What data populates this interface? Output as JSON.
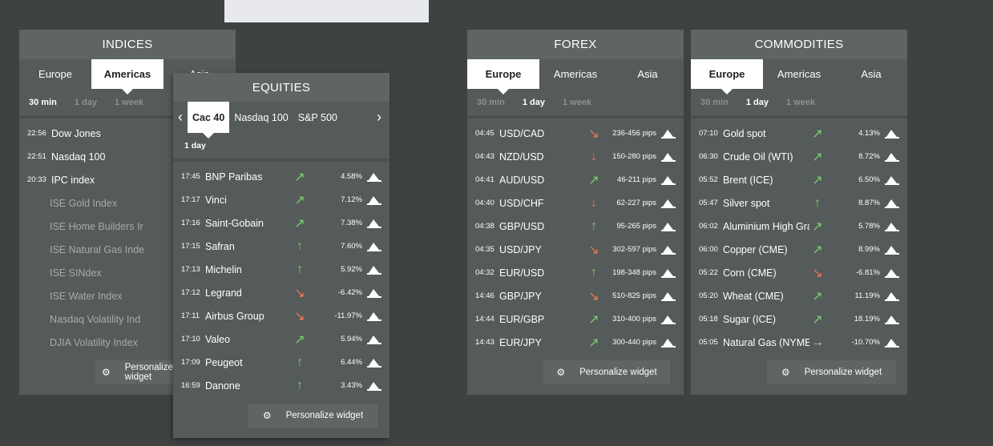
{
  "indices": {
    "title": "INDICES",
    "tabs": [
      "Europe",
      "Americas",
      "Asia"
    ],
    "active_tab": 1,
    "periods": [
      "30 min",
      "1 day",
      "1 week"
    ],
    "active_period": 0,
    "rows": [
      {
        "time": "22:56",
        "name": "Dow Jones",
        "arrow": "↗"
      },
      {
        "time": "22:51",
        "name": "Nasdaq 100",
        "arrow": "↗"
      },
      {
        "time": "20:33",
        "name": "IPC index",
        "arrow": "↗"
      }
    ],
    "dim_rows": [
      "ISE Gold Index",
      "ISE Home Builders Ir",
      "ISE Natural Gas Inde",
      "ISE SINdex",
      "ISE Water Index",
      "Nasdaq Volatility Ind",
      "DJIA Volatility Index"
    ],
    "dash": "-",
    "personalize": "Personalize widget"
  },
  "equities": {
    "title": "EQUITIES",
    "sub_tabs": [
      "Cac 40",
      "Nasdaq 100",
      "S&P 500"
    ],
    "period": "1 day",
    "rows": [
      {
        "time": "17:45",
        "name": "BNP Paribas",
        "arrow": "↗",
        "dir": "up-green",
        "val": "4.58%"
      },
      {
        "time": "17:17",
        "name": "Vinci",
        "arrow": "↗",
        "dir": "up-green",
        "val": "7.12%"
      },
      {
        "time": "17:16",
        "name": "Saint-Gobain",
        "arrow": "↗",
        "dir": "up-green",
        "val": "7.38%"
      },
      {
        "time": "17:15",
        "name": "Safran",
        "arrow": "↑",
        "dir": "up-green",
        "val": "7.60%"
      },
      {
        "time": "17:13",
        "name": "Michelin",
        "arrow": "↑",
        "dir": "up-green",
        "val": "5.92%"
      },
      {
        "time": "17:12",
        "name": "Legrand",
        "arrow": "↘",
        "dir": "down-red",
        "val": "-6.42%"
      },
      {
        "time": "17:11",
        "name": "Airbus Group",
        "arrow": "↘",
        "dir": "down-red",
        "val": "-11.97%"
      },
      {
        "time": "17:10",
        "name": "Valeo",
        "arrow": "↗",
        "dir": "up-green",
        "val": "5.94%"
      },
      {
        "time": "17:09",
        "name": "Peugeot",
        "arrow": "↑",
        "dir": "up-green",
        "val": "6.44%"
      },
      {
        "time": "16:59",
        "name": "Danone",
        "arrow": "↑",
        "dir": "up-green",
        "val": "3.43%"
      }
    ],
    "personalize": "Personalize widget"
  },
  "forex": {
    "title": "FOREX",
    "tabs": [
      "Europe",
      "Americas",
      "Asia"
    ],
    "active_tab": 0,
    "periods": [
      "30 min",
      "1 day",
      "1 week"
    ],
    "active_period": 1,
    "rows": [
      {
        "time": "04:45",
        "name": "USD/CAD",
        "arrow": "↘",
        "dir": "down-red",
        "val": "236-456 pips"
      },
      {
        "time": "04:43",
        "name": "NZD/USD",
        "arrow": "↓",
        "dir": "down-red",
        "val": "150-280 pips"
      },
      {
        "time": "04:41",
        "name": "AUD/USD",
        "arrow": "↗",
        "dir": "up-green",
        "val": "46-211 pips"
      },
      {
        "time": "04:40",
        "name": "USD/CHF",
        "arrow": "↓",
        "dir": "down-red",
        "val": "62-227 pips"
      },
      {
        "time": "04:38",
        "name": "GBP/USD",
        "arrow": "↑",
        "dir": "up-green",
        "val": "95-265 pips"
      },
      {
        "time": "04:35",
        "name": "USD/JPY",
        "arrow": "↘",
        "dir": "down-red",
        "val": "302-597 pips"
      },
      {
        "time": "04:32",
        "name": "EUR/USD",
        "arrow": "↑",
        "dir": "up-green",
        "val": "198-348 pips"
      },
      {
        "time": "14:46",
        "name": "GBP/JPY",
        "arrow": "↘",
        "dir": "down-red",
        "val": "510-825 pips"
      },
      {
        "time": "14:44",
        "name": "EUR/GBP",
        "arrow": "↗",
        "dir": "up-green",
        "val": "310-400 pips"
      },
      {
        "time": "14:43",
        "name": "EUR/JPY",
        "arrow": "↗",
        "dir": "up-green",
        "val": "300-440 pips"
      }
    ],
    "personalize": "Personalize widget"
  },
  "commodities": {
    "title": "COMMODITIES",
    "tabs": [
      "Europe",
      "Americas",
      "Asia"
    ],
    "active_tab": 0,
    "periods": [
      "30 min",
      "1 day",
      "1 week"
    ],
    "active_period": 1,
    "rows": [
      {
        "time": "07:10",
        "name": "Gold spot",
        "arrow": "↗",
        "dir": "up-green",
        "val": "4.13%"
      },
      {
        "time": "06:30",
        "name": "Crude Oil (WTI)",
        "arrow": "↗",
        "dir": "up-green",
        "val": "8.72%"
      },
      {
        "time": "05:52",
        "name": "Brent (ICE)",
        "arrow": "↗",
        "dir": "up-green",
        "val": "6.50%"
      },
      {
        "time": "05:47",
        "name": "Silver spot",
        "arrow": "↑",
        "dir": "up-green",
        "val": "8.87%"
      },
      {
        "time": "06:02",
        "name": "Aluminium High Gra",
        "arrow": "↗",
        "dir": "up-green",
        "val": "5.78%"
      },
      {
        "time": "06:00",
        "name": "Copper (CME)",
        "arrow": "↗",
        "dir": "up-green",
        "val": "8.99%"
      },
      {
        "time": "05:22",
        "name": "Corn (CME)",
        "arrow": "↘",
        "dir": "down-red",
        "val": "-6.81%"
      },
      {
        "time": "05:20",
        "name": "Wheat (CME)",
        "arrow": "↗",
        "dir": "up-green",
        "val": "11.19%"
      },
      {
        "time": "05:18",
        "name": "Sugar (ICE)",
        "arrow": "↗",
        "dir": "up-green",
        "val": "18.19%"
      },
      {
        "time": "05:05",
        "name": "Natural Gas (NYMEX",
        "arrow": "→",
        "dir": "gray",
        "val": "-10.70%"
      }
    ],
    "personalize": "Personalize widget"
  },
  "colors": {
    "bg": "#3e4241",
    "panel": "#555a5a",
    "up": "#7cd06b",
    "down": "#f07a52"
  },
  "icons": {
    "gear": "gear-icon",
    "chart": "area-chart-icon",
    "chevron_left": "chevron-left-icon",
    "chevron_right": "chevron-right-icon"
  }
}
